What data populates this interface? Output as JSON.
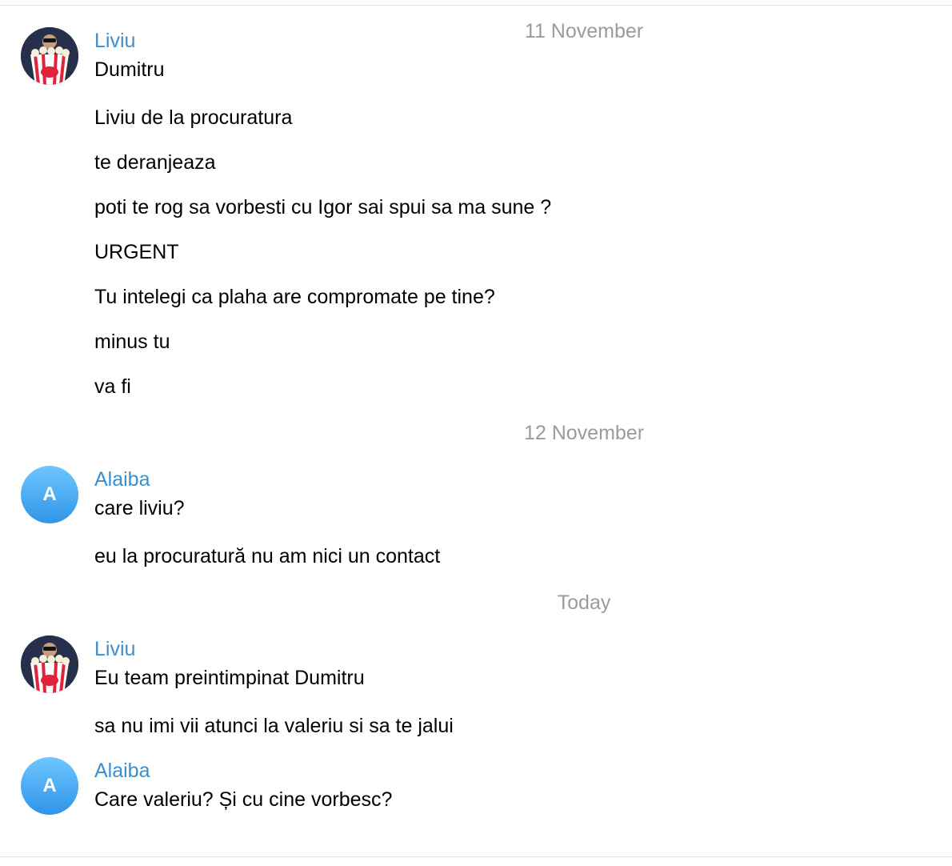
{
  "dates": [
    "11 November",
    "12 November",
    "Today"
  ],
  "groups": [
    {
      "sender": "Liviu",
      "avatar": "photo-avatar",
      "messages": [
        "Dumitru",
        "Liviu de la procuratura",
        "te deranjeaza",
        "poti te rog sa vorbesti cu Igor sai spui sa ma sune ?",
        "URGENT",
        "Tu intelegi ca plaha are compromate pe tine?",
        "minus tu",
        "va fi"
      ]
    },
    {
      "sender": "Alaiba",
      "avatar_letter": "A",
      "messages": [
        "care liviu?",
        "eu la procuratură nu am nici un contact"
      ]
    },
    {
      "sender": "Liviu",
      "avatar": "photo-avatar",
      "messages": [
        "Eu team preintimpinat Dumitru",
        "sa nu imi vii atunci la valeriu si sa te jalui"
      ]
    },
    {
      "sender": "Alaiba",
      "avatar_letter": "A",
      "messages": [
        "Care valeriu? Și cu cine vorbesc?"
      ]
    }
  ],
  "colors": {
    "sender_name": "#3a8fd0",
    "date_text": "#9b9b9b",
    "avatar_gradient_top": "#6ec6ff",
    "avatar_gradient_bottom": "#2f95e8"
  }
}
